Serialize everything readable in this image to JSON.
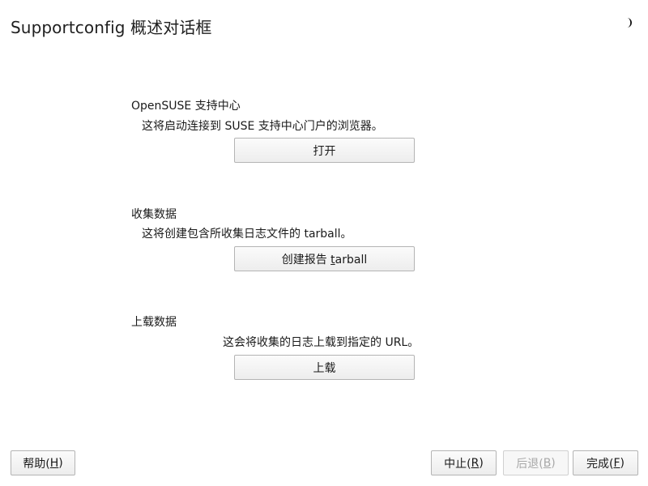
{
  "window": {
    "title": "Supportconfig 概述对话框",
    "theme_icon": "moon-icon"
  },
  "sections": {
    "support": {
      "heading": "OpenSUSE 支持中心",
      "description": "这将启动连接到 SUSE 支持中心门户的浏览器。",
      "button_label": "打开"
    },
    "collect": {
      "heading": "收集数据",
      "description": "这将创建包含所收集日志文件的 tarball。",
      "button_prefix": "创建报告 ",
      "button_mnemonic": "t",
      "button_suffix": "arball"
    },
    "upload": {
      "heading": "上载数据",
      "description": "这会将收集的日志上载到指定的 URL。",
      "button_label": "上载"
    }
  },
  "footer": {
    "help": {
      "prefix": "帮助(",
      "mnemonic": "H",
      "suffix": ")"
    },
    "abort": {
      "prefix": "中止(",
      "mnemonic": "R",
      "suffix": ")"
    },
    "back": {
      "prefix": "后退(",
      "mnemonic": "B",
      "suffix": ")",
      "disabled": true
    },
    "finish": {
      "prefix": "完成(",
      "mnemonic": "F",
      "suffix": ")"
    }
  }
}
